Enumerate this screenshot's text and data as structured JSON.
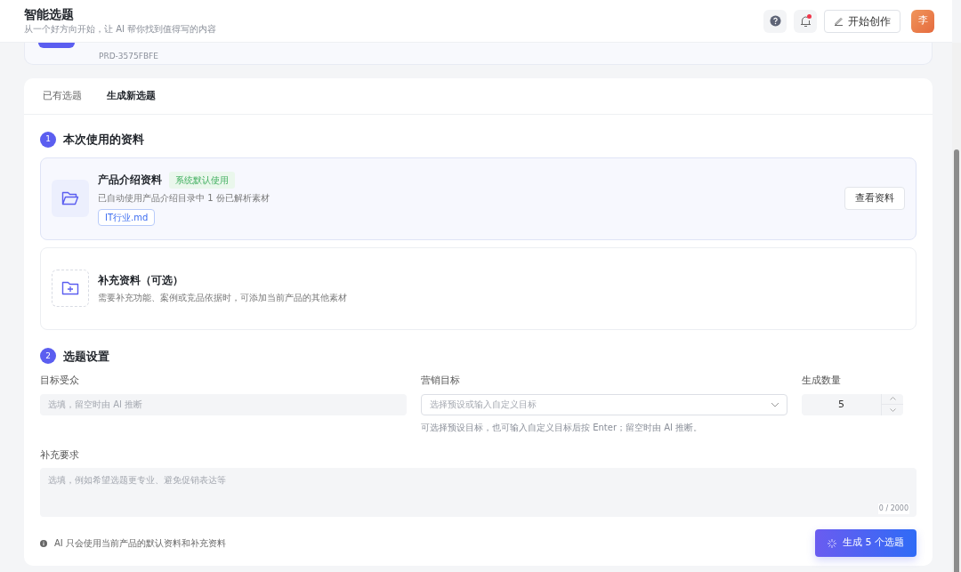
{
  "header": {
    "title": "智能选题",
    "subtitle": "从一个好方向开始，让 AI 帮你找到值得写的内容",
    "has_notification": true,
    "create_button": "开始创作",
    "avatar": "李"
  },
  "product": {
    "code": "PRD-3575FBFE"
  },
  "tabs": [
    {
      "label": "已有选题",
      "selected": false
    },
    {
      "label": "生成新选题",
      "selected": true
    }
  ],
  "materials_section": {
    "step": "1",
    "title": "本次使用的资料",
    "materials": [
      {
        "kind": "default",
        "title": "产品介绍资料",
        "badge": "系统默认使用",
        "description": "已自动使用产品介绍目录中 1 份已解析素材",
        "file": "IT行业.md",
        "action": "查看资料"
      },
      {
        "kind": "optional",
        "title": "补充资料（可选）",
        "description": "需要补充功能、案例或竞品依据时，可添加当前产品的其他素材"
      }
    ]
  },
  "settings_section": {
    "step": "2",
    "title": "选题设置",
    "audience": {
      "label": "目标受众",
      "placeholder": "选填，留空时由 AI 推断"
    },
    "goal": {
      "label": "营销目标",
      "placeholder": "选择预设或输入自定义目标",
      "hint": "可选择预设目标，也可输入自定义目标后按 Enter；留空时由 AI 推断。"
    },
    "count": {
      "label": "生成数量",
      "value": "5"
    },
    "requirements": {
      "label": "补充要求",
      "placeholder": "选填，例如希望选题更专业、避免促销表达等",
      "counter": "0 / 2000"
    },
    "note": "AI 只会使用当前产品的默认资料和补充资料",
    "generate_button": "生成 5 个选题"
  }
}
